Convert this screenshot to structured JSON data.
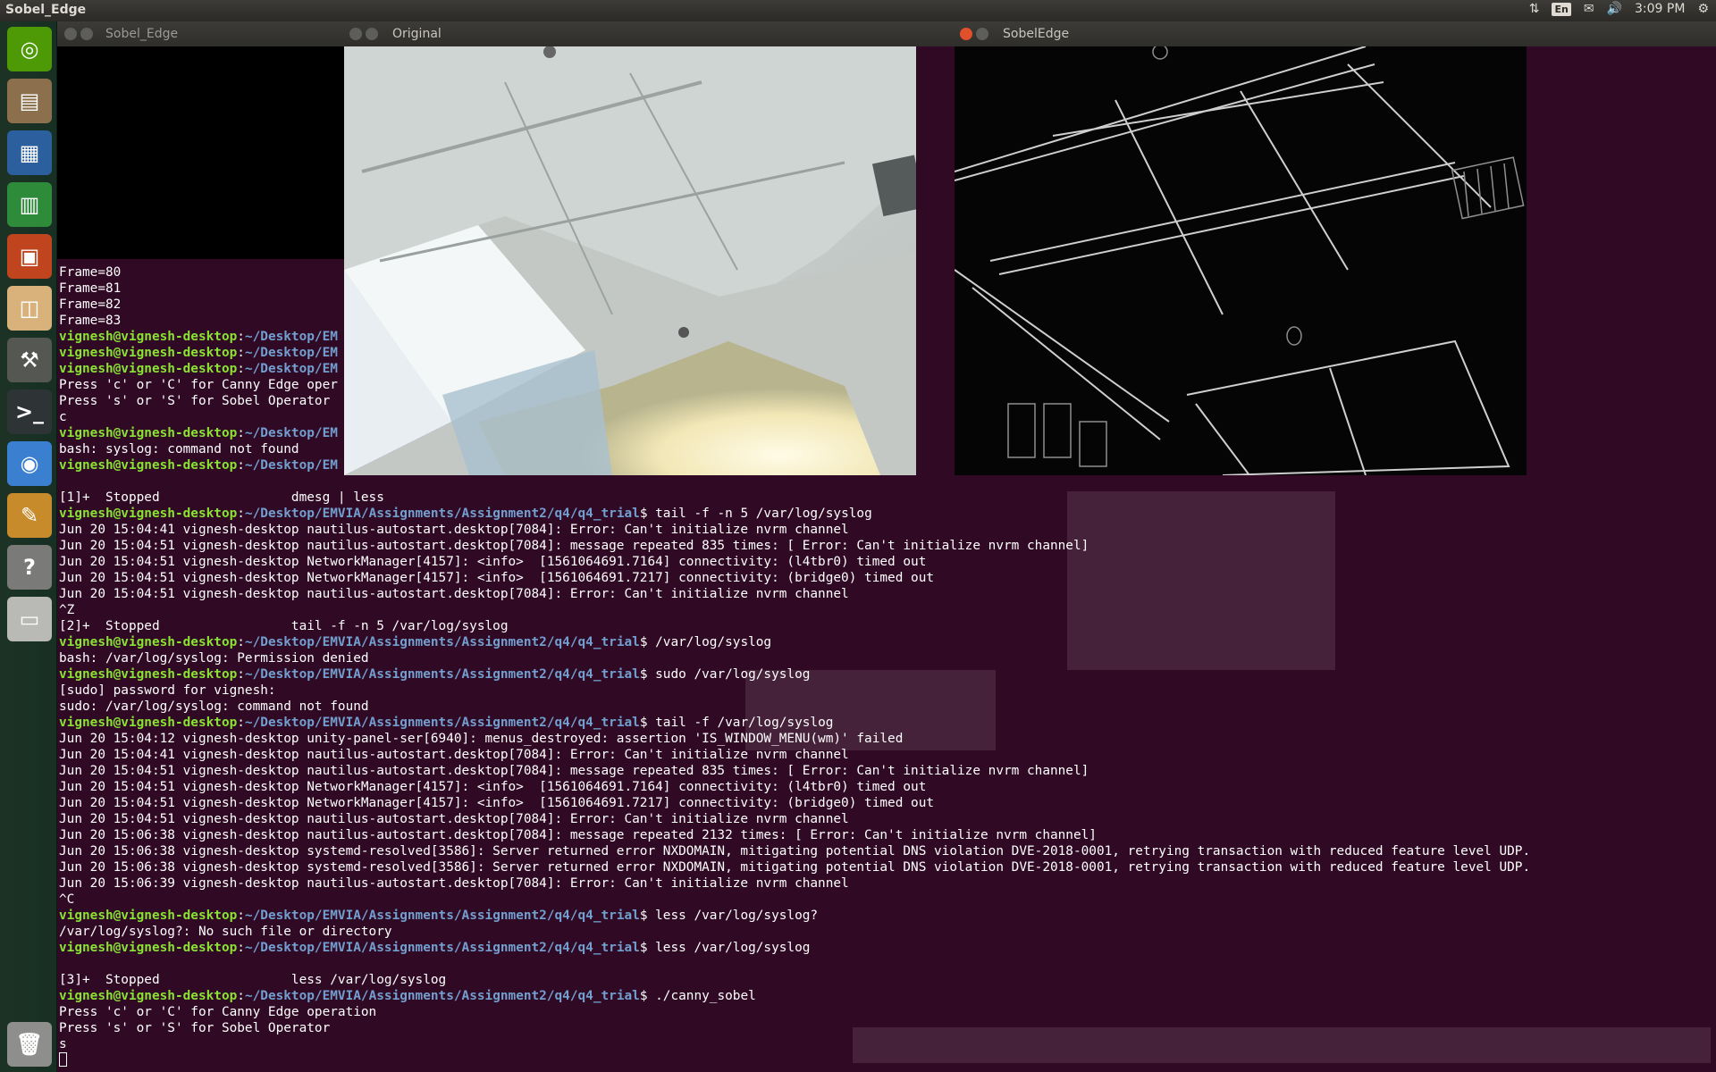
{
  "top_panel": {
    "app_title": "Sobel_Edge",
    "indicators": {
      "network_icon": "network-updown-icon",
      "language": "En",
      "mail_icon": "mail-icon",
      "volume_icon": "volume-icon",
      "time": "3:09 PM",
      "settings_icon": "gear-icon"
    }
  },
  "launcher": {
    "items": [
      {
        "name": "ubuntu-dash",
        "icon": "ubuntu-logo-icon",
        "color": "#4e9a06"
      },
      {
        "name": "files",
        "icon": "file-cabinet-icon",
        "color": "#8c6f4c"
      },
      {
        "name": "writer",
        "icon": "document-icon",
        "color": "#2c5f9e"
      },
      {
        "name": "calc",
        "icon": "spreadsheet-icon",
        "color": "#2e8b3a"
      },
      {
        "name": "impress",
        "icon": "presentation-icon",
        "color": "#c0451f"
      },
      {
        "name": "software-center",
        "icon": "shopping-bag-icon",
        "color": "#d9b27b"
      },
      {
        "name": "system-settings",
        "icon": "wrench-gear-icon",
        "color": "#555753"
      },
      {
        "name": "terminal",
        "icon": "terminal-icon",
        "color": "#2e3436"
      },
      {
        "name": "chromium",
        "icon": "browser-icon",
        "color": "#3b7fd1"
      },
      {
        "name": "text-editor",
        "icon": "notepad-icon",
        "color": "#c88b2b"
      },
      {
        "name": "help",
        "icon": "question-icon",
        "color": "#7a7a78"
      },
      {
        "name": "drive",
        "icon": "drive-icon",
        "color": "#b9b9b6"
      },
      {
        "name": "trash",
        "icon": "trash-icon",
        "color": "#8e8e8c"
      }
    ]
  },
  "terminal": {
    "window_title": "Sobel_Edge",
    "lines": [
      {
        "text": "Frame=80"
      },
      {
        "text": "Frame=81"
      },
      {
        "text": "Frame=82"
      },
      {
        "text": "Frame=83"
      },
      {
        "user": "vignesh@vignesh-desktop",
        "path": "~/Desktop/EM",
        "text": ""
      },
      {
        "user": "vignesh@vignesh-desktop",
        "path": "~/Desktop/EM",
        "text": ""
      },
      {
        "user": "vignesh@vignesh-desktop",
        "path": "~/Desktop/EM",
        "text": ""
      },
      {
        "text": "Press 'c' or 'C' for Canny Edge oper"
      },
      {
        "text": "Press 's' or 'S' for Sobel Operator"
      },
      {
        "text": "c"
      },
      {
        "user": "vignesh@vignesh-desktop",
        "path": "~/Desktop/EM",
        "text": ""
      },
      {
        "text": "bash: syslog: command not found"
      },
      {
        "user": "vignesh@vignesh-desktop",
        "path": "~/Desktop/EM",
        "text": ""
      },
      {
        "text": ""
      },
      {
        "text": "[1]+  Stopped                 dmesg | less"
      },
      {
        "user": "vignesh@vignesh-desktop",
        "path": "~/Desktop/EMVIA/Assignments/Assignment2/q4/q4_trial",
        "text": "$ tail -f -n 5 /var/log/syslog"
      },
      {
        "text": "Jun 20 15:04:41 vignesh-desktop nautilus-autostart.desktop[7084]: Error: Can't initialize nvrm channel"
      },
      {
        "text": "Jun 20 15:04:51 vignesh-desktop nautilus-autostart.desktop[7084]: message repeated 835 times: [ Error: Can't initialize nvrm channel]"
      },
      {
        "text": "Jun 20 15:04:51 vignesh-desktop NetworkManager[4157]: <info>  [1561064691.7164] connectivity: (l4tbr0) timed out"
      },
      {
        "text": "Jun 20 15:04:51 vignesh-desktop NetworkManager[4157]: <info>  [1561064691.7217] connectivity: (bridge0) timed out"
      },
      {
        "text": "Jun 20 15:04:51 vignesh-desktop nautilus-autostart.desktop[7084]: Error: Can't initialize nvrm channel"
      },
      {
        "text": "^Z"
      },
      {
        "text": "[2]+  Stopped                 tail -f -n 5 /var/log/syslog"
      },
      {
        "user": "vignesh@vignesh-desktop",
        "path": "~/Desktop/EMVIA/Assignments/Assignment2/q4/q4_trial",
        "text": "$ /var/log/syslog"
      },
      {
        "text": "bash: /var/log/syslog: Permission denied"
      },
      {
        "user": "vignesh@vignesh-desktop",
        "path": "~/Desktop/EMVIA/Assignments/Assignment2/q4/q4_trial",
        "text": "$ sudo /var/log/syslog"
      },
      {
        "text": "[sudo] password for vignesh:"
      },
      {
        "text": "sudo: /var/log/syslog: command not found"
      },
      {
        "user": "vignesh@vignesh-desktop",
        "path": "~/Desktop/EMVIA/Assignments/Assignment2/q4/q4_trial",
        "text": "$ tail -f /var/log/syslog"
      },
      {
        "text": "Jun 20 15:04:12 vignesh-desktop unity-panel-ser[6940]: menus_destroyed: assertion 'IS_WINDOW_MENU(wm)' failed"
      },
      {
        "text": "Jun 20 15:04:41 vignesh-desktop nautilus-autostart.desktop[7084]: Error: Can't initialize nvrm channel"
      },
      {
        "text": "Jun 20 15:04:51 vignesh-desktop nautilus-autostart.desktop[7084]: message repeated 835 times: [ Error: Can't initialize nvrm channel]"
      },
      {
        "text": "Jun 20 15:04:51 vignesh-desktop NetworkManager[4157]: <info>  [1561064691.7164] connectivity: (l4tbr0) timed out"
      },
      {
        "text": "Jun 20 15:04:51 vignesh-desktop NetworkManager[4157]: <info>  [1561064691.7217] connectivity: (bridge0) timed out"
      },
      {
        "text": "Jun 20 15:04:51 vignesh-desktop nautilus-autostart.desktop[7084]: Error: Can't initialize nvrm channel"
      },
      {
        "text": "Jun 20 15:06:38 vignesh-desktop nautilus-autostart.desktop[7084]: message repeated 2132 times: [ Error: Can't initialize nvrm channel]"
      },
      {
        "text": "Jun 20 15:06:38 vignesh-desktop systemd-resolved[3586]: Server returned error NXDOMAIN, mitigating potential DNS violation DVE-2018-0001, retrying transaction with reduced feature level UDP."
      },
      {
        "text": "Jun 20 15:06:38 vignesh-desktop systemd-resolved[3586]: Server returned error NXDOMAIN, mitigating potential DNS violation DVE-2018-0001, retrying transaction with reduced feature level UDP."
      },
      {
        "text": "Jun 20 15:06:39 vignesh-desktop nautilus-autostart.desktop[7084]: Error: Can't initialize nvrm channel"
      },
      {
        "text": "^C"
      },
      {
        "user": "vignesh@vignesh-desktop",
        "path": "~/Desktop/EMVIA/Assignments/Assignment2/q4/q4_trial",
        "text": "$ less /var/log/syslog?"
      },
      {
        "text": "/var/log/syslog?: No such file or directory"
      },
      {
        "user": "vignesh@vignesh-desktop",
        "path": "~/Desktop/EMVIA/Assignments/Assignment2/q4/q4_trial",
        "text": "$ less /var/log/syslog"
      },
      {
        "text": ""
      },
      {
        "text": "[3]+  Stopped                 less /var/log/syslog"
      },
      {
        "user": "vignesh@vignesh-desktop",
        "path": "~/Desktop/EMVIA/Assignments/Assignment2/q4/q4_trial",
        "text": "$ ./canny_sobel"
      },
      {
        "text": "Press 'c' or 'C' for Canny Edge operation"
      },
      {
        "text": "Press 's' or 'S' for Sobel Operator"
      },
      {
        "text": "s"
      },
      {
        "text": "",
        "cursor": true
      }
    ]
  },
  "windows": {
    "original": {
      "title": "Original"
    },
    "sobel": {
      "title": "SobelEdge"
    }
  }
}
